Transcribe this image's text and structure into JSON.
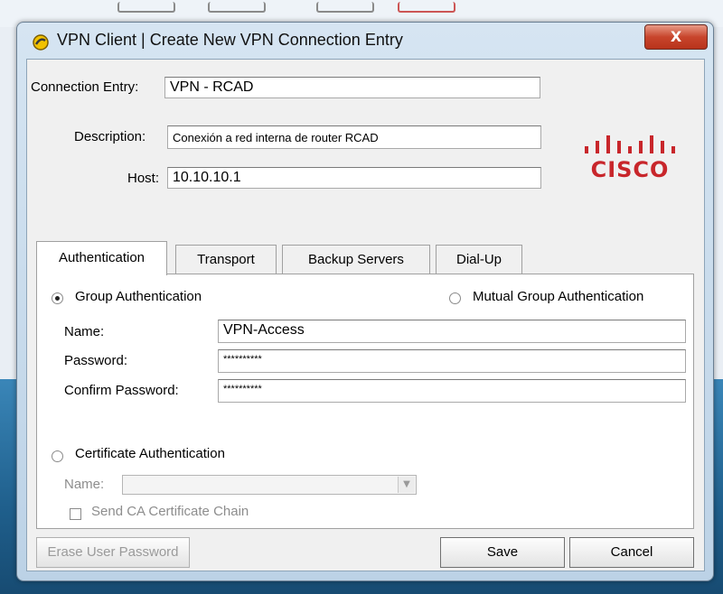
{
  "window": {
    "title": "VPN Client  |  Create New VPN Connection Entry",
    "close_label": "X"
  },
  "form": {
    "connection_entry_label": "Connection Entry:",
    "connection_entry_value": "VPN - RCAD",
    "description_label": "Description:",
    "description_value": "Conexión a red interna de router RCAD",
    "host_label": "Host:",
    "host_value": "10.10.10.1"
  },
  "logo": {
    "text": "CISCO",
    "alt": "cisco-logo"
  },
  "tabs": [
    {
      "label": "Authentication",
      "active": true
    },
    {
      "label": "Transport"
    },
    {
      "label": "Backup Servers"
    },
    {
      "label": "Dial-Up"
    }
  ],
  "auth": {
    "group_auth_label": "Group Authentication",
    "group_auth_selected": true,
    "mutual_auth_label": "Mutual Group Authentication",
    "name_label": "Name:",
    "name_value": "VPN-Access",
    "password_label": "Password:",
    "password_value": "**********",
    "confirm_label": "Confirm Password:",
    "confirm_value": "**********",
    "cert_auth_label": "Certificate Authentication",
    "cert_name_label": "Name:",
    "send_ca_label": "Send CA Certificate Chain"
  },
  "buttons": {
    "erase_label": "Erase User Password",
    "save_label": "Save",
    "cancel_label": "Cancel"
  }
}
